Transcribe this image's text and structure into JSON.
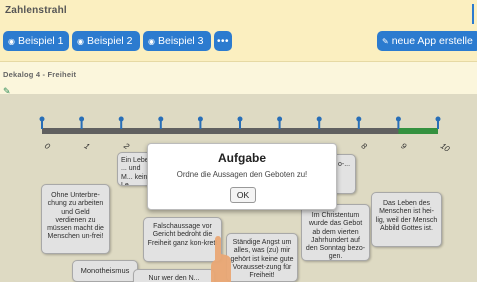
{
  "app": {
    "title": "Zahlenstrahl",
    "subtitle": "Dekalog 4 - Freiheit"
  },
  "toolbar": {
    "example1": "Beispiel 1",
    "example2": "Beispiel 2",
    "example3": "Beispiel 3",
    "more": "•••",
    "new_app": "neue App erstelle",
    "icons": {
      "example": "eye-icon",
      "new_app": "pencil-icon",
      "hint": "pencil-note-icon"
    }
  },
  "numberline": {
    "ticks": [
      "0",
      "1",
      "2",
      "3",
      "4",
      "5",
      "6",
      "7",
      "8",
      "9",
      "10"
    ],
    "axis_color": "#6b6b6b",
    "highlight_color": "#3aa346",
    "marker_color": "#2c7bcf"
  },
  "cards": [
    {
      "text": "Ohne Unterbre-chung zu arbeiten und Geld verdienen zu müssen macht die Menschen un-frei!"
    },
    {
      "text": "Monotheismus"
    },
    {
      "text": "Ein Leben ... und M... kein Le..."
    },
    {
      "text": "Falschaussage vor Gericht bedroht die Freiheit ganz kon-kret!"
    },
    {
      "text": "Nur wer den N..."
    },
    {
      "text": "Ständige Angst um alles, was (zu) mir gehört ist keine gute Vorausset-zung für Freiheit!"
    },
    {
      "text": "Im Christentum wurde das Gebot ab dem vierten Jahrhundert auf den Sonntag bezo-gen."
    },
    {
      "text": "Das Leben des Menschen ist hei-lig, weil der Mensch Abbild Gottes ist."
    },
    {
      "text": "o-..."
    }
  ],
  "dialog": {
    "title": "Aufgabe",
    "message": "Ordne die Aussagen den Geboten zu!",
    "ok": "OK"
  }
}
